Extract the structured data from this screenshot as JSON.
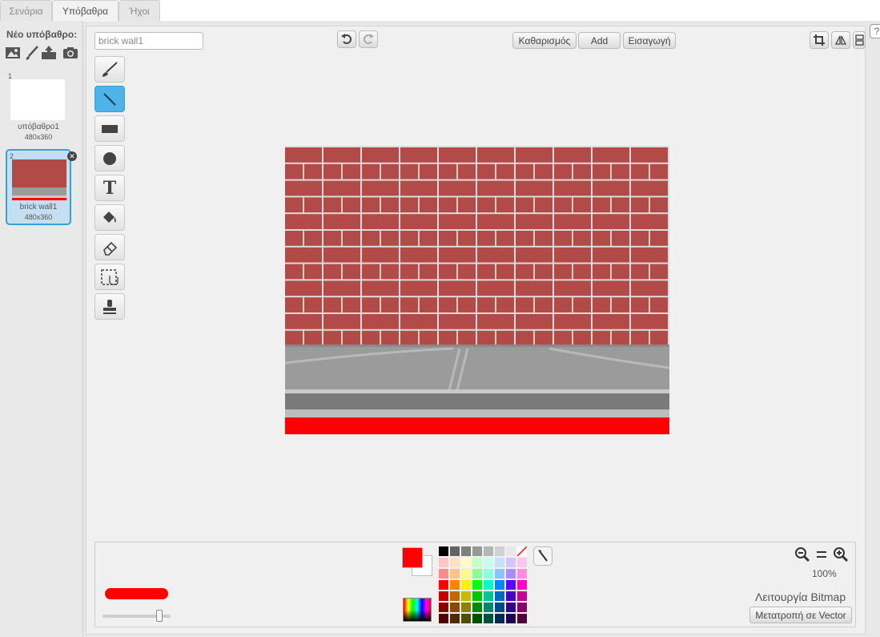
{
  "tabs": [
    {
      "label": "Σενάρια"
    },
    {
      "label": "Υπόβαθρα"
    },
    {
      "label": "Ήχοι"
    }
  ],
  "new_backdrop_label": "Νέο υπόβαθρο:",
  "new_backdrop_icons": [
    "library-image-icon",
    "paint-brush-icon",
    "upload-icon",
    "camera-icon"
  ],
  "backdrops": [
    {
      "number": "1",
      "name": "υπόβαθρο1",
      "size": "480x360"
    },
    {
      "number": "2",
      "name": "brick wall1",
      "size": "480x360",
      "selected": true
    }
  ],
  "editor": {
    "name_value": "brick wall1",
    "buttons": {
      "clear": "Καθαρισμός",
      "add": "Add",
      "import": "Εισαγωγή"
    },
    "tools": [
      "brush-icon",
      "line-icon",
      "rectangle-icon",
      "ellipse-icon",
      "text-icon",
      "fill-icon",
      "eraser-icon",
      "select-icon",
      "stamp-icon"
    ],
    "selected_tool": "line-icon",
    "text_tool_glyph": "T"
  },
  "bottom": {
    "zoom": "100%",
    "mode": "Λειτουργία Bitmap",
    "convert": "Μετατροπή σε Vector",
    "foreground_color": "#ff0000",
    "background_color": "#ffffff",
    "palette": [
      "#000000",
      "#636363",
      "#7f7f7f",
      "#989898",
      "#b5b5b5",
      "#d1d1d1",
      "#e8e8e8",
      "transparent",
      "#ffc4c4",
      "#ffe0c4",
      "#fffcc4",
      "#c6ffc4",
      "#c4fff0",
      "#c4e1ff",
      "#d6c4ff",
      "#ffc4ef",
      "#ff8a8a",
      "#ffc18a",
      "#fff88a",
      "#8aff90",
      "#8affe2",
      "#8ac3ff",
      "#ae8aff",
      "#ff8ae0",
      "#ff0000",
      "#ff8500",
      "#fff300",
      "#00ff0d",
      "#00ffc5",
      "#0087ff",
      "#5c00ff",
      "#ff00c2",
      "#c50000",
      "#c56700",
      "#c5bb00",
      "#00c50a",
      "#00c598",
      "#0068c5",
      "#4700c5",
      "#c50096",
      "#8a0000",
      "#8a4800",
      "#8a8300",
      "#008a07",
      "#008a6b",
      "#00498a",
      "#32008a",
      "#8a0069",
      "#500000",
      "#502a00",
      "#504c00",
      "#005004",
      "#00503e",
      "#002a50",
      "#1d0050",
      "#50003d"
    ]
  },
  "help_glyph": "?"
}
